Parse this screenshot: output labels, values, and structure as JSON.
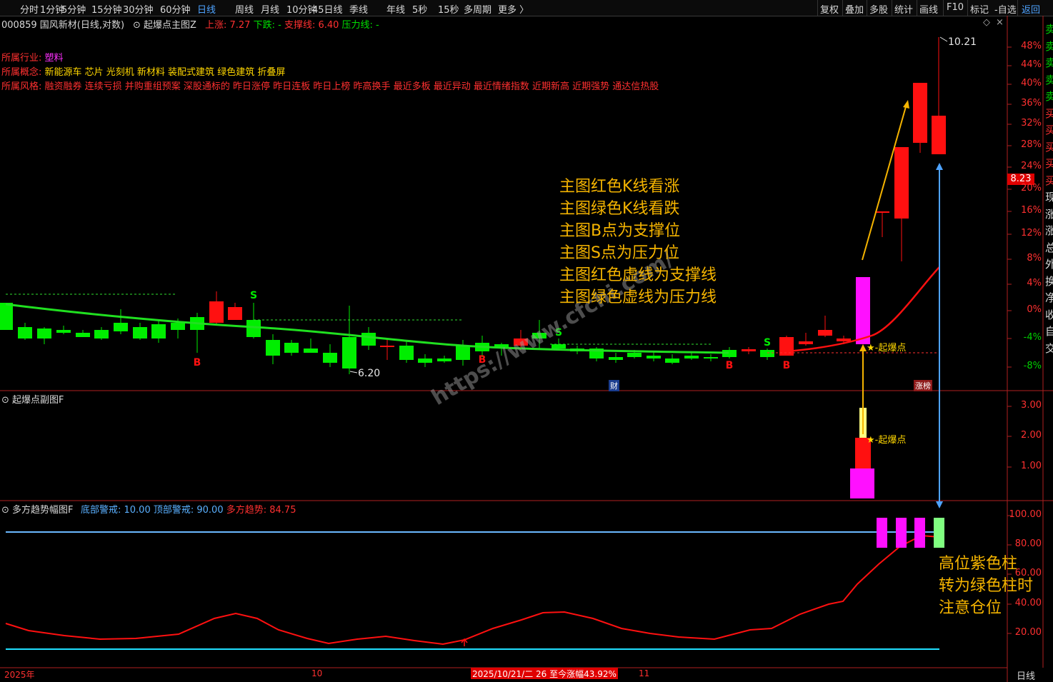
{
  "toolbar": {
    "tabs": [
      "分时",
      "1分钟",
      "5分钟",
      "15分钟",
      "30分钟",
      "60分钟",
      "日线",
      "周线",
      "月线",
      "10分钟",
      "45日线",
      "季线",
      "年线",
      "5秒",
      "15秒",
      "多周期",
      "更多 〉"
    ],
    "active_tab": "日线",
    "right_tabs": [
      "复权",
      "叠加",
      "多股",
      "统计",
      "画线",
      "F10",
      "标记",
      "-自选",
      "返回"
    ]
  },
  "main_panel": {
    "stock_title": "000859 国风新材(日线,对数)",
    "indicator_name": "起爆点主图Z",
    "params": [
      {
        "label": "上涨: 7.27",
        "color": "#ff3030"
      },
      {
        "label": "下跌: -",
        "color": "#00e000"
      },
      {
        "label": "支撑线: 6.40",
        "color": "#ff3030"
      },
      {
        "label": "压力线: -",
        "color": "#00e000"
      }
    ],
    "industry": {
      "label": "所属行业:",
      "value": "塑料"
    },
    "concepts": {
      "label": "所属概念:",
      "value": "新能源车 芯片 光刻机 新材料 装配式建筑 绿色建筑 折叠屏"
    },
    "styles": {
      "label": "所属风格:",
      "value": "融资融券 连续亏损 并购重组预案 深股通标的 昨日涨停 昨日连板 昨日上榜 昨高换手 最近多板 最近异动 最近情绪指数 近期新高 近期强势 通达信热股"
    },
    "annotation_lines": [
      "主图红色K线看涨",
      "主图绿色K线看跌",
      "主图B点为支撑位",
      "主图S点为压力位",
      "主图红色虚线为支撑线",
      "主图绿色虚线为压力线"
    ],
    "high_label": "10.21",
    "low_label": "6.20",
    "last_price": "8.23",
    "signal_label": "起爆点",
    "markers": {
      "B": "B",
      "S": "S",
      "cai": "财",
      "zhang": "涨榜"
    },
    "pct_axis": [
      "48%",
      "44%",
      "40%",
      "36%",
      "32%",
      "28%",
      "24%",
      "20%",
      "16%",
      "12%",
      "8%",
      "4%",
      "0%",
      "-4%",
      "-8%"
    ]
  },
  "sub_panel": {
    "title": "起爆点副图F",
    "signal_label": "起爆点",
    "axis": [
      "3.00",
      "2.00",
      "1.00"
    ]
  },
  "trend_panel": {
    "title": "多方趋势幅图F",
    "params": [
      {
        "label": "底部警戒: 10.00",
        "color": "#5ab0ff"
      },
      {
        "label": "顶部警戒: 90.00",
        "color": "#5ab0ff"
      },
      {
        "label": "多方趋势: 84.75",
        "color": "#ff3030"
      }
    ],
    "annotation_lines": [
      "高位紫色柱",
      "转为绿色柱时",
      "注意仓位"
    ],
    "axis": [
      "100.00",
      "80.00",
      "60.00",
      "40.00",
      "20.00"
    ]
  },
  "bottom": {
    "year_label": "2025年",
    "month_10": "10",
    "month_11": "11",
    "status": "2025/10/21/二 26 至今涨幅43.92%",
    "period": "日线"
  },
  "right_strip": [
    "卖",
    "卖",
    "卖",
    "卖",
    "卖",
    "买",
    "买",
    "买",
    "买",
    "买",
    "现",
    "涨",
    "涨",
    "总",
    "外",
    "换",
    "净",
    "收",
    "自",
    "交"
  ],
  "watermark": "https://www.cfchi.com/",
  "colors": {
    "up": "#ff1010",
    "down": "#00ee00",
    "magenta": "#ff00ff",
    "accent": "#f5b400",
    "blue": "#4ea3ff"
  }
}
